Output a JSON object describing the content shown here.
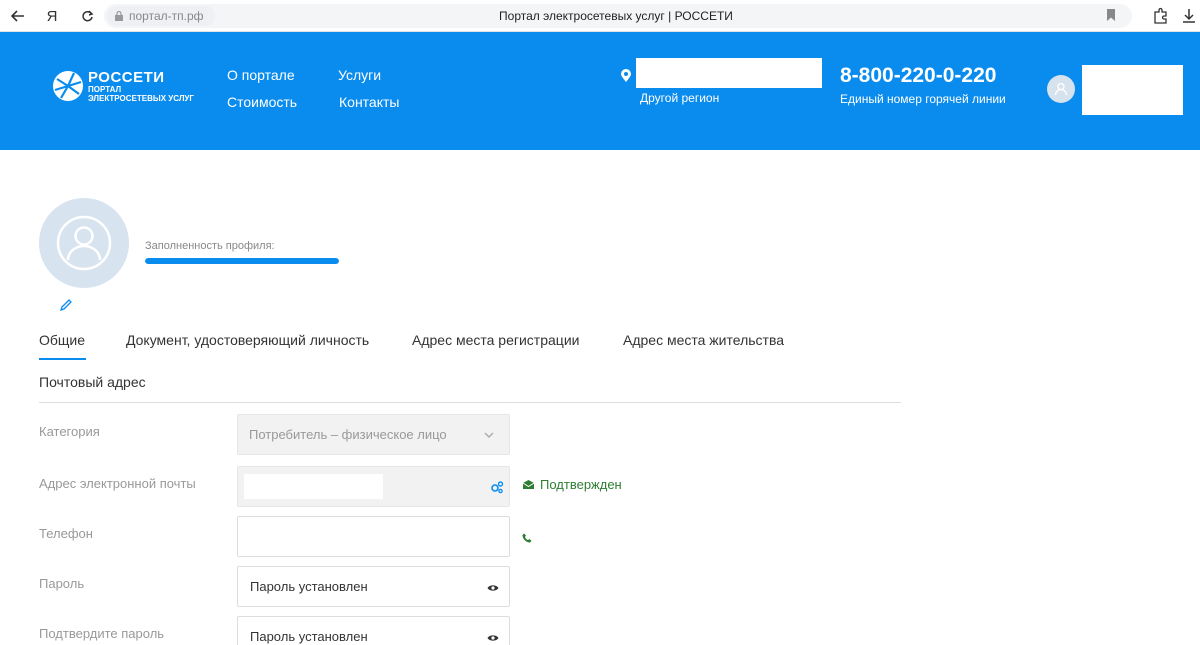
{
  "browser": {
    "yandex_glyph": "Я",
    "address": "портал-тп.рф",
    "tab_title": "Портал электросетевых услуг | РОССЕТИ",
    "icons": [
      "back-arrow-icon",
      "reload-icon",
      "lock-icon",
      "bookmark-icon",
      "extensions-icon",
      "downloads-icon"
    ]
  },
  "header": {
    "logo": {
      "brand": "РОССЕТИ",
      "sub_line1": "ПОРТАЛ",
      "sub_line2": "ЭЛЕКТРОСЕТЕВЫХ УСЛУГ"
    },
    "nav": [
      {
        "label": "О портале"
      },
      {
        "label": "Услуги"
      },
      {
        "label": "Стоимость"
      },
      {
        "label": "Контакты"
      }
    ],
    "region_link": "Другой регион",
    "phone": "8-800-220-0-220",
    "phone_caption": "Единый номер горячей линии",
    "accent_color": "#0a8cef"
  },
  "profile": {
    "completeness_label": "Заполненность профиля:",
    "completeness_fraction": 1.0
  },
  "tabs": [
    {
      "label": "Общие",
      "active": true
    },
    {
      "label": "Документ, удостоверяющий личность",
      "active": false
    },
    {
      "label": "Адрес места регистрации",
      "active": false
    },
    {
      "label": "Адрес места жительства",
      "active": false
    },
    {
      "label": "Почтовый адрес",
      "active": false
    }
  ],
  "form": {
    "category": {
      "label": "Категория",
      "value": "Потребитель – физическое лицо"
    },
    "email": {
      "label": "Адрес электронной почты",
      "status": "Подтвержден"
    },
    "phone": {
      "label": "Телефон",
      "value": ""
    },
    "password": {
      "label": "Пароль",
      "value": "Пароль установлен"
    },
    "confirm_password": {
      "label": "Подтвердите пароль",
      "value": "Пароль установлен"
    }
  }
}
